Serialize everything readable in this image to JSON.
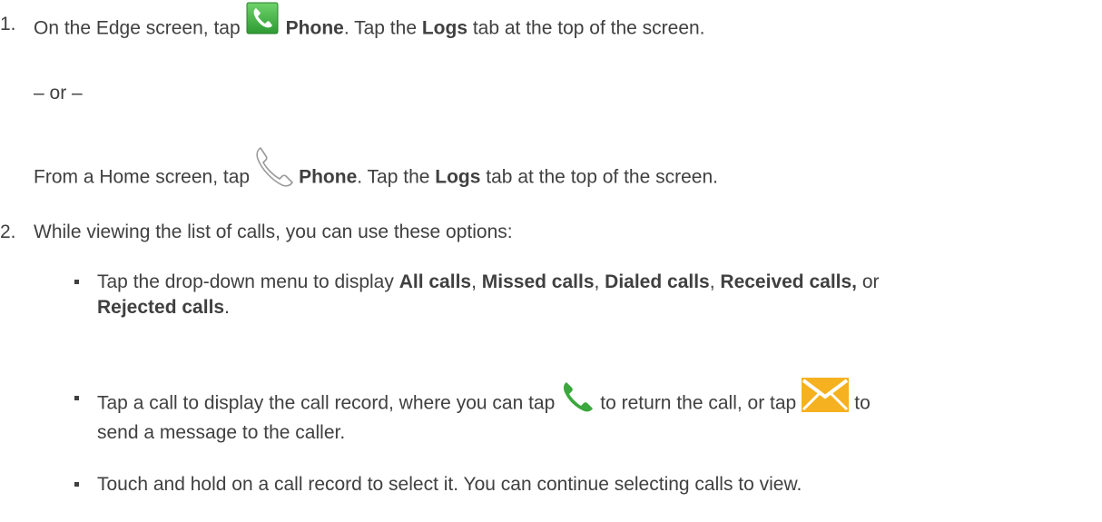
{
  "step1": {
    "number": "1.",
    "edge": {
      "prefix": "On the Edge screen, tap",
      "app": "Phone",
      "middle": ". Tap the ",
      "tab": "Logs",
      "suffix": " tab at the top of the screen."
    },
    "or_text": "– or –",
    "home": {
      "prefix": "From a Home screen, tap",
      "app": "Phone",
      "middle": ". Tap the ",
      "tab": "Logs",
      "suffix": " tab at the top of the screen."
    }
  },
  "step2": {
    "number": "2.",
    "text": "While viewing the list of calls, you can use these options:",
    "bullets": {
      "b1": {
        "prefix": "Tap the drop-down menu to display ",
        "all": "All calls",
        "sep1": ", ",
        "missed": "Missed calls",
        "sep2": ", ",
        "dialed": "Dialed calls",
        "sep3": ", ",
        "received": "Received calls,",
        "or": " or",
        "rejected": "Rejected calls",
        "end": "."
      },
      "b2": {
        "prefix": "Tap a call to display the call record, where you can tap",
        "middle": "to return the call, or tap",
        "suffix": "to",
        "line2": "send a message to the caller."
      },
      "b3": {
        "text": "Touch and hold on a call record to select it. You can continue selecting calls to view."
      }
    }
  },
  "icons": {
    "edge_phone": "phone-app-green-icon",
    "home_phone": "phone-outline-icon",
    "call": "green-call-icon",
    "message": "envelope-orange-icon"
  },
  "colors": {
    "text": "#404040",
    "phone_green": "#3aa83c",
    "message_orange": "#f5b11f"
  }
}
